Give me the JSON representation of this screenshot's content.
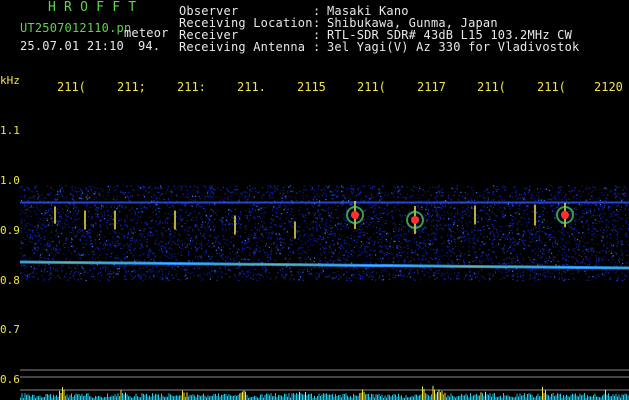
{
  "header": {
    "brand": "H R O F F T",
    "filename": "UT2507012110.pn",
    "mode": "meteor",
    "datetime": "25.07.01 21:10",
    "count": "94.",
    "observer_key": "Observer",
    "location_key": "Receiving Location",
    "receiver_key": "Receiver",
    "antenna_key": "Receiving Antenna",
    "sep": ":",
    "observer": "Masaki Kano",
    "location": "Shibukawa, Gunma, Japan",
    "receiver": "RTL-SDR SDR# 43dB L15 103.2MHz CW",
    "antenna": "3el Yagi(V) Az 330 for Vladivostok"
  },
  "axis": {
    "unit": "kHz",
    "time_ticks": [
      "211(",
      "211;",
      "211:",
      "211.",
      "2115",
      "211(",
      "2117",
      "211(",
      "211(",
      "2120"
    ],
    "freq_ticks": [
      "1.1",
      "1.0",
      "0.9",
      "0.8",
      "0.7",
      "0.6"
    ]
  },
  "colors": {
    "background": "#000000",
    "text_green": "#5cd64a",
    "text_white": "#e8e8e8",
    "text_yellow": "#f2e640",
    "noise": "#1a2fd0",
    "carrier_band": "#2a9aff",
    "meteor": "#ff3030"
  },
  "spectrogram": {
    "freq_range_khz": [
      0.6,
      1.13
    ],
    "noise_band_khz": [
      0.8,
      0.99
    ],
    "carrier_khz": 0.83,
    "upper_line_khz": 0.955,
    "meteor_echoes": [
      {
        "time": "2111",
        "freq_khz": 0.93,
        "strength": 0.4
      },
      {
        "time": "2111",
        "freq_khz": 0.92,
        "strength": 0.5
      },
      {
        "time": "2112",
        "freq_khz": 0.92,
        "strength": 0.5
      },
      {
        "time": "2113",
        "freq_khz": 0.92,
        "strength": 0.5
      },
      {
        "time": "2114",
        "freq_khz": 0.91,
        "strength": 0.5
      },
      {
        "time": "2115",
        "freq_khz": 0.9,
        "strength": 0.4
      },
      {
        "time": "2116",
        "freq_khz": 0.93,
        "strength": 1.0
      },
      {
        "time": "2117",
        "freq_khz": 0.92,
        "strength": 1.0
      },
      {
        "time": "2118",
        "freq_khz": 0.93,
        "strength": 0.5
      },
      {
        "time": "2119",
        "freq_khz": 0.93,
        "strength": 0.6
      },
      {
        "time": "2119",
        "freq_khz": 0.93,
        "strength": 0.8
      }
    ]
  }
}
